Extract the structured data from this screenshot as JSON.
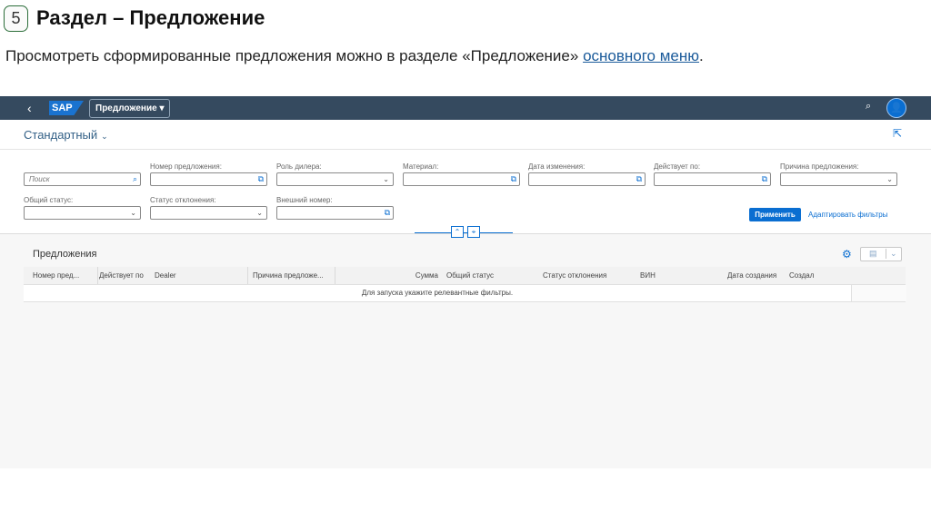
{
  "slide": {
    "number": "5",
    "title": "Раздел – Предложение",
    "intro_text": "Просмотреть сформированные предложения можно в разделе «Предложение» ",
    "intro_link": "основного меню",
    "intro_end": "."
  },
  "shell": {
    "back_icon": "‹",
    "logo": "SAP",
    "menu_label": "Предложение ▾",
    "search_icon": "⌕",
    "avatar_icon": "👤"
  },
  "header": {
    "variant": "Стандартный",
    "variant_chevron": "⌄",
    "share_icon": "⇱"
  },
  "filters": {
    "search_placeholder": "Поиск",
    "offer_number_label": "Номер предложения:",
    "dealer_role_label": "Роль дилера:",
    "material_label": "Материал:",
    "change_date_label": "Дата изменения:",
    "valid_until_label": "Действует по:",
    "offer_reason_label": "Причина предложения:",
    "overall_status_label": "Общий статус:",
    "rejection_status_label": "Статус отклонения:",
    "external_number_label": "Внешний номер:",
    "apply_button": "Применить",
    "adapt_button": "Адаптировать фильтры",
    "collapse_icon": "⌃",
    "pin_icon": "⌖"
  },
  "table": {
    "title": "Предложения",
    "settings_icon": "⚙",
    "columns": [
      "Номер пред...",
      "Действует по",
      "Dealer",
      "Причина предложе...",
      "Сумма",
      "Общий статус",
      "Статус отклонения",
      "ВИН",
      "Дата создания",
      "Создал"
    ],
    "empty_text": "Для запуска укажите релевантные фильтры."
  }
}
